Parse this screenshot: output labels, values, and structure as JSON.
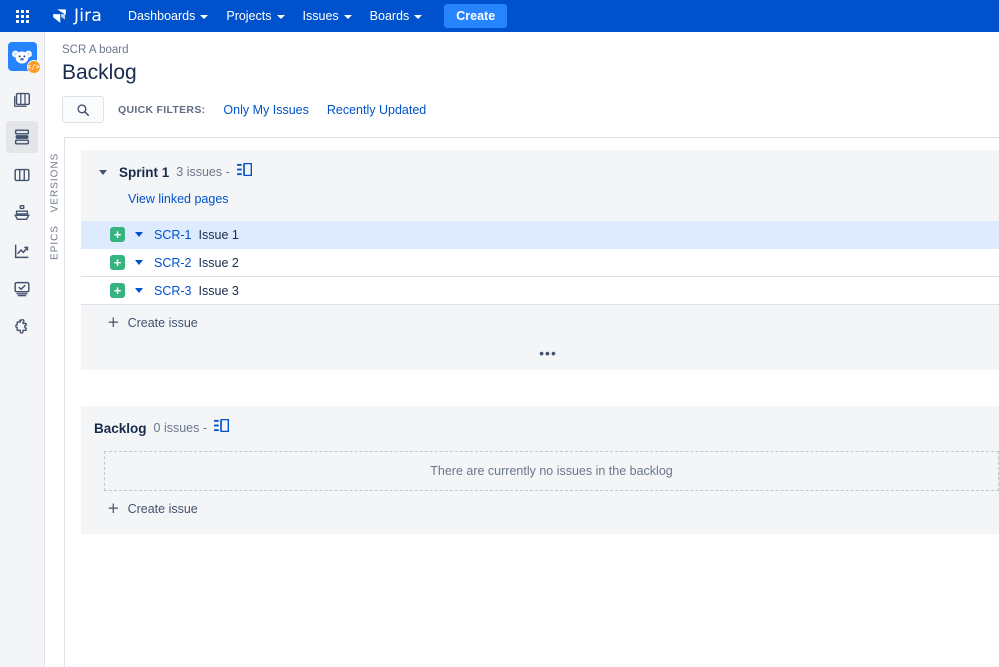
{
  "topnav": {
    "app_switcher_icon": "grid-apps-icon",
    "logo_text": "Jira",
    "items": [
      {
        "label": "Dashboards",
        "icon": "chevron-down-icon"
      },
      {
        "label": "Projects",
        "icon": "chevron-down-icon"
      },
      {
        "label": "Issues",
        "icon": "chevron-down-icon"
      },
      {
        "label": "Boards",
        "icon": "chevron-down-icon"
      }
    ],
    "create_label": "Create",
    "bg_color": "#0052CC",
    "create_color": "#2684FF"
  },
  "sidebar": {
    "project_avatar_icon": "koala-project-avatar",
    "project_badge_icon": "code-badge-icon",
    "project_badge_text": "</>",
    "items": [
      {
        "name": "roadmap-icon",
        "active": false
      },
      {
        "name": "backlog-icon",
        "active": true
      },
      {
        "name": "board-icon",
        "active": false
      },
      {
        "name": "releases-icon",
        "active": false
      },
      {
        "name": "reports-icon",
        "active": false
      },
      {
        "name": "issues-icon",
        "active": false
      },
      {
        "name": "addons-icon",
        "active": false
      }
    ]
  },
  "vertical_tabs": [
    {
      "label": "VERSIONS"
    },
    {
      "label": "EPICS"
    }
  ],
  "header": {
    "breadcrumb": "SCR A board",
    "title": "Backlog",
    "search_icon": "search-icon",
    "search_value": "",
    "search_placeholder": "",
    "quick_filters_label": "QUICK FILTERS:",
    "quick_filters": [
      {
        "label": "Only My Issues"
      },
      {
        "label": "Recently Updated"
      }
    ]
  },
  "sprint": {
    "caret_icon": "chevron-down-icon",
    "title": "Sprint 1",
    "count": "3 issues -",
    "estimate_icon": "estimate-badge-icon",
    "linked_pages_label": "View linked pages",
    "issues": [
      {
        "type_icon": "story-plus-icon",
        "chevron_icon": "chevron-down-icon",
        "key": "SCR-1",
        "summary": "Issue 1",
        "selected": true
      },
      {
        "type_icon": "story-plus-icon",
        "chevron_icon": "chevron-down-icon",
        "key": "SCR-2",
        "summary": "Issue 2",
        "selected": false
      },
      {
        "type_icon": "story-plus-icon",
        "chevron_icon": "chevron-down-icon",
        "key": "SCR-3",
        "summary": "Issue 3",
        "selected": false
      }
    ],
    "create_issue_label": "Create issue",
    "more_icon": "more-dots-icon",
    "more_label": "•••"
  },
  "backlog": {
    "title": "Backlog",
    "count": "0 issues -",
    "estimate_icon": "estimate-badge-icon",
    "empty_message": "There are currently no issues in the backlog",
    "create_issue_label": "Create issue"
  },
  "colors": {
    "nav_blue": "#0052CC",
    "link_blue": "#0052CC",
    "selected_row": "#DEEBFF",
    "story_green": "#36B37E",
    "panel_gray": "#F4F5F7",
    "badge_orange": "#FF991F"
  }
}
